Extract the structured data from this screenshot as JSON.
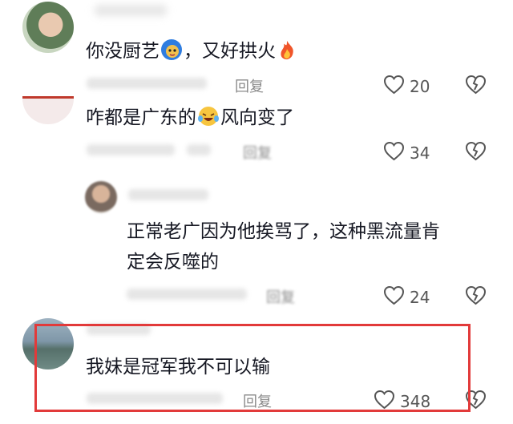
{
  "comments": [
    {
      "text_before": "你没厨艺",
      "emoji": "face-with-hood-emoji",
      "text_after": "，又好拱火",
      "trailing_emoji": "fire-emoji",
      "reply_label": "回复",
      "likes": "20"
    },
    {
      "text_before": "咋都是广东的",
      "emoji": "laughing-tears-emoji",
      "text_after": "风向变了",
      "reply_label": "回复",
      "likes": "34"
    },
    {
      "line1": "正常老广因为他挨骂了，这种黑流量肯",
      "line2": "定会反噬的",
      "reply_label": "回复",
      "likes": "24"
    },
    {
      "text": "我妹是冠军我不可以输",
      "reply_label": "回复",
      "likes": "348"
    }
  ],
  "colors": {
    "highlight": "#e23a3a",
    "text": "#161823",
    "meta": "#8a8a8a"
  }
}
